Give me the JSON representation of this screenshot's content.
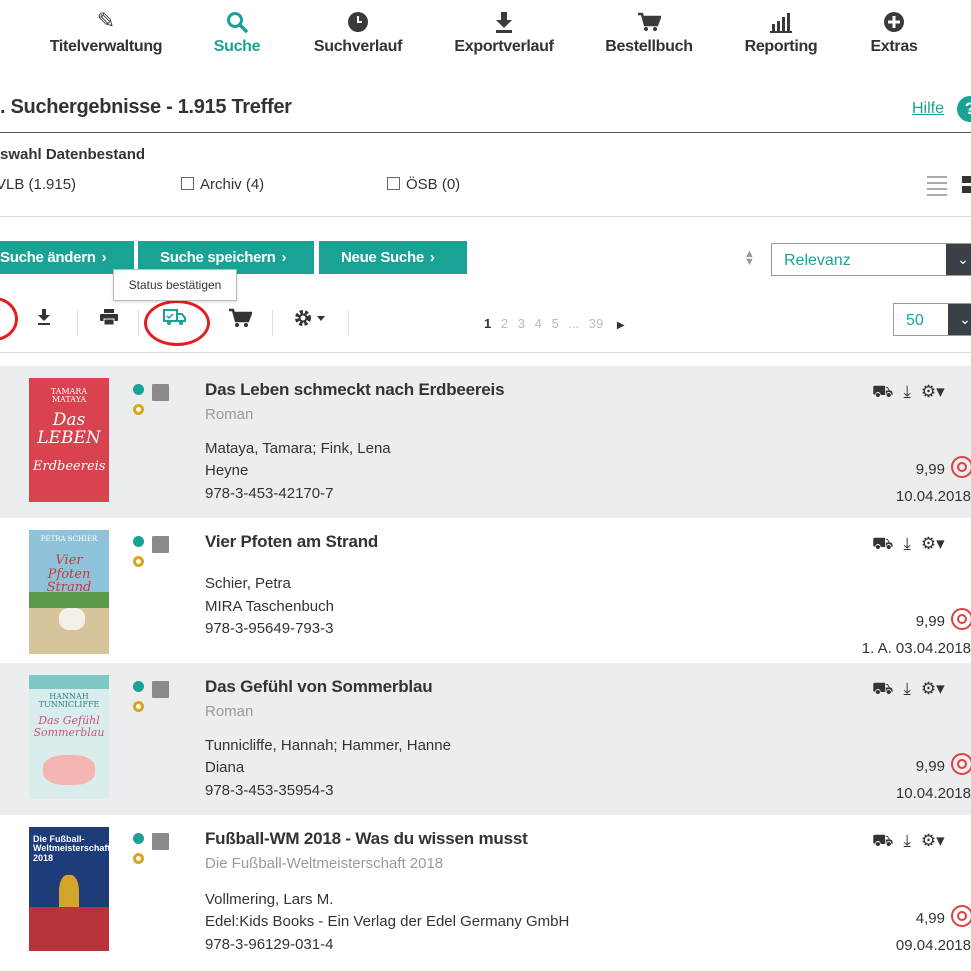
{
  "nav": {
    "items": [
      {
        "label": "Titelverwaltung",
        "icon": "pencil-icon"
      },
      {
        "label": "Suche",
        "icon": "search-icon"
      },
      {
        "label": "Suchverlauf",
        "icon": "clock-icon"
      },
      {
        "label": "Exportverlauf",
        "icon": "download-icon"
      },
      {
        "label": "Bestellbuch",
        "icon": "cart-icon"
      },
      {
        "label": "Reporting",
        "icon": "bar-chart-icon"
      },
      {
        "label": "Extras",
        "icon": "plus-circle-icon"
      }
    ],
    "active": "Suche"
  },
  "header": {
    "title": ". Suchergebnisse - 1.915 Treffer",
    "help_label": "Hilfe",
    "help_icon": "?"
  },
  "datasource": {
    "title": "swahl Datenbestand",
    "options": [
      {
        "label": "VLB (1.915)",
        "checked": true
      },
      {
        "label": "Archiv (4)",
        "checked": false
      },
      {
        "label": "ÖSB (0)",
        "checked": false
      }
    ]
  },
  "actions": {
    "change_search": "Suche ändern",
    "save_search": "Suche speichern",
    "new_search": "Neue Suche"
  },
  "sort": {
    "selected": "Relevanz"
  },
  "tooltip": "Status bestätigen",
  "pagination": {
    "pages": [
      "1",
      "2",
      "3",
      "4",
      "5",
      "...",
      "39"
    ],
    "current": "1",
    "per_page": "50"
  },
  "results": [
    {
      "title": "Das Leben schmeckt nach Erdbeereis",
      "subtitle": "Roman",
      "author": "Mataya, Tamara; Fink, Lena",
      "publisher": "Heyne",
      "isbn": "978-3-453-42170-7",
      "price": "9,99",
      "date": "10.04.2018",
      "cover_text": "TAMARA MATAYA · Das LEBEN schmeckt nach Erdbeereis",
      "cover_color": "#d9434f"
    },
    {
      "title": "Vier Pfoten am Strand",
      "subtitle": "",
      "author": "Schier, Petra",
      "publisher": "MIRA Taschenbuch",
      "isbn": "978-3-95649-793-3",
      "price": "9,99",
      "date": "1. A. 03.04.2018",
      "cover_text": "PETRA SCHIER · Vier Pfoten am Strand",
      "cover_color": "#8fc3d9"
    },
    {
      "title": "Das Gefühl von Sommerblau",
      "subtitle": "Roman",
      "author": "Tunnicliffe, Hannah; Hammer, Hanne",
      "publisher": "Diana",
      "isbn": "978-3-453-35954-3",
      "price": "9,99",
      "date": "10.04.2018",
      "cover_text": "HANNAH TUNNICLIFFE · Das Gefühl von Sommerblau",
      "cover_color": "#7cc6c4"
    },
    {
      "title": "Fußball-WM 2018 - Was du wissen musst",
      "subtitle": "Die Fußball-Weltmeisterschaft 2018",
      "author": "Vollmering, Lars M.",
      "publisher": "Edel:Kids Books - Ein Verlag der Edel Germany GmbH",
      "isbn": "978-3-96129-031-4",
      "price": "4,99",
      "date": "09.04.2018",
      "cover_text": "Die Fußball-Weltmeisterschaft 2018",
      "cover_color": "#1e3c7a"
    }
  ],
  "colors": {
    "accent": "#1aa394",
    "dark_select": "#3b3f46",
    "annotation_red": "#e02020",
    "row_alt": "#ecedef"
  }
}
